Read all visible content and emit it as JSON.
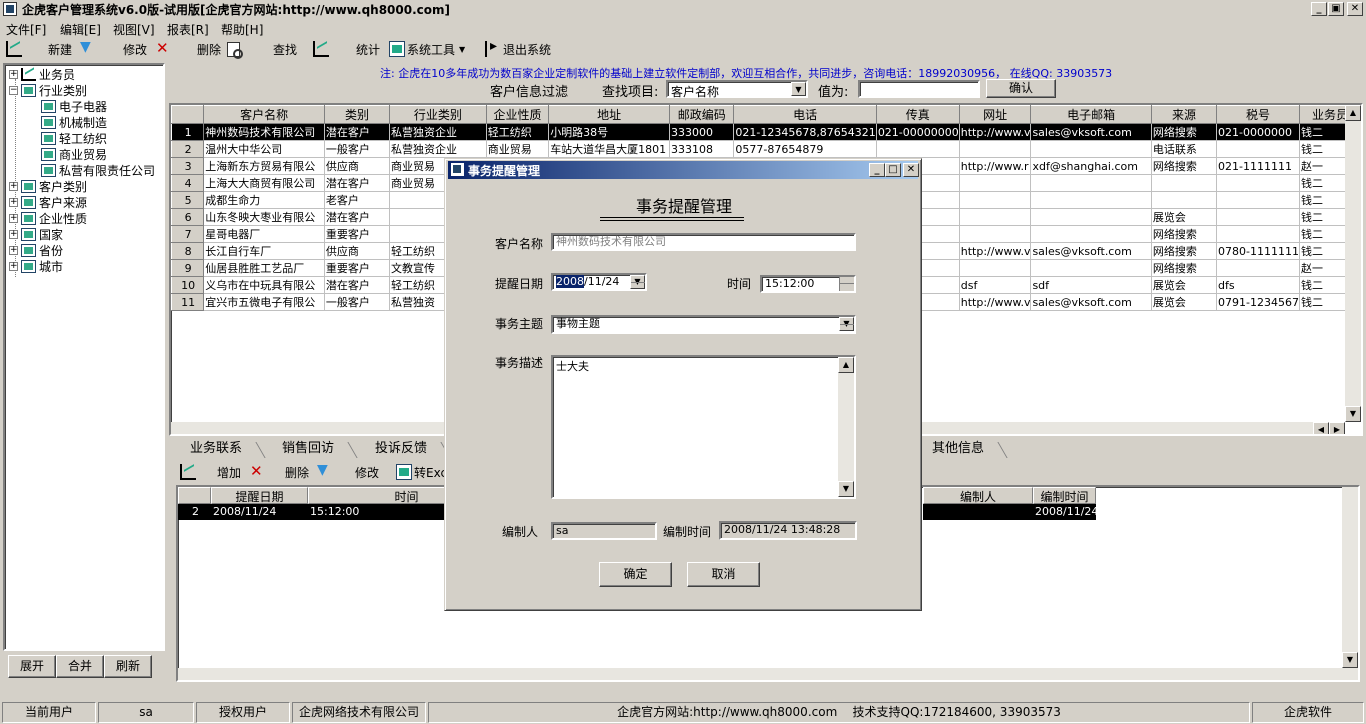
{
  "window": {
    "title": "企虎客户管理系统v6.0版-试用版[企虎官方网站:http://www.qh8000.com]",
    "caption_buttons": [
      "_",
      "▣",
      "✕"
    ]
  },
  "menu": [
    "文件[F]",
    "编辑[E]",
    "视图[V]",
    "报表[R]",
    "帮助[H]"
  ],
  "toolbar": {
    "new": "新建",
    "edit": "修改",
    "delete": "删除",
    "find": "查找",
    "stats": "统计",
    "tools": "系统工具",
    "exit": "退出系统"
  },
  "tree": {
    "nodes": [
      {
        "label": "业务员",
        "expander": "+",
        "level": 0
      },
      {
        "label": "行业类别",
        "expander": "−",
        "level": 0
      },
      {
        "label": "电子电器",
        "level": 1
      },
      {
        "label": "机械制造",
        "level": 1
      },
      {
        "label": "轻工纺织",
        "level": 1
      },
      {
        "label": "商业贸易",
        "level": 1
      },
      {
        "label": "私营有限责任公司",
        "level": 1
      },
      {
        "label": "客户类别",
        "expander": "+",
        "level": 0
      },
      {
        "label": "客户来源",
        "expander": "+",
        "level": 0
      },
      {
        "label": "企业性质",
        "expander": "+",
        "level": 0
      },
      {
        "label": "国家",
        "expander": "+",
        "level": 0
      },
      {
        "label": "省份",
        "expander": "+",
        "level": 0
      },
      {
        "label": "城市",
        "expander": "+",
        "level": 0
      }
    ],
    "buttons": {
      "expand": "展开",
      "collapse": "合并",
      "refresh": "刷新"
    }
  },
  "notice": "注: 企虎在10多年成功为数百家企业定制软件的基础上建立软件定制部，欢迎互相合作，共同进步，咨询电话：18992030956， 在线QQ: 33903573",
  "filter": {
    "title": "客户信息过滤",
    "item_label": "查找项目:",
    "item_value": "客户名称",
    "value_label": "值为:",
    "value": "",
    "confirm": "确认"
  },
  "grid": {
    "columns": [
      "",
      "客户名称",
      "类别",
      "行业类别",
      "企业性质",
      "地址",
      "邮政编码",
      "电话",
      "传真",
      "网址",
      "电子邮箱",
      "来源",
      "税号",
      "业务员"
    ],
    "rows": [
      [
        "1",
        "神州数码技术有限公司",
        "潜在客户",
        "私营独资企业",
        "轻工纺织",
        "小明路38号",
        "333000",
        "021-12345678,87654321",
        "021-00000000",
        "http://www.v",
        "sales@vksoft.com",
        "网络搜索",
        "021-0000000",
        "钱二"
      ],
      [
        "2",
        "温州大中华公司",
        "一般客户",
        "私营独资企业",
        "商业贸易",
        "车站大道华昌大厦1801",
        "333108",
        "0577-87654879",
        "",
        "",
        "",
        "电话联系",
        "",
        "钱二"
      ],
      [
        "3",
        "上海新东方贸易有限公",
        "供应商",
        "商业贸易",
        "",
        "",
        "",
        "",
        "",
        "http://www.r",
        "xdf@shanghai.com",
        "网络搜索",
        "021-1111111",
        "赵一"
      ],
      [
        "4",
        "上海大大商贸有限公司",
        "潜在客户",
        "商业贸易",
        "",
        "",
        "",
        "",
        "",
        "",
        "",
        "",
        "",
        "钱二"
      ],
      [
        "5",
        "成都生命力",
        "老客户",
        "",
        "",
        "",
        "",
        "",
        "",
        "",
        "",
        "",
        "",
        "钱二"
      ],
      [
        "6",
        "山东冬映大枣业有限公",
        "潜在客户",
        "",
        "",
        "",
        "",
        "",
        "",
        "",
        "",
        "展览会",
        "",
        "钱二"
      ],
      [
        "7",
        "星哥电器厂",
        "重要客户",
        "",
        "",
        "",
        "",
        "",
        "",
        "",
        "",
        "网络搜索",
        "",
        "钱二"
      ],
      [
        "8",
        "长江自行车厂",
        "供应商",
        "轻工纺织",
        "",
        "",
        "",
        "",
        "",
        "http://www.v",
        "sales@vksoft.com",
        "网络搜索",
        "0780-1111111",
        "钱二"
      ],
      [
        "9",
        "仙居县胜胜工艺品厂",
        "重要客户",
        "文教宣传",
        "",
        "",
        "",
        "",
        "",
        "",
        "",
        "网络搜索",
        "",
        "赵一"
      ],
      [
        "10",
        "义乌市在中玩具有限公",
        "潜在客户",
        "轻工纺织",
        "",
        "",
        "",
        "",
        "",
        "dsf",
        "sdf",
        "展览会",
        "dfs",
        "钱二"
      ],
      [
        "11",
        "宜兴市五微电子有限公",
        "一般客户",
        "私营独资",
        "",
        "",
        "",
        "",
        "",
        "http://www.v",
        "sales@vksoft.com",
        "展览会",
        "0791-1234567",
        "钱二"
      ]
    ]
  },
  "tabs": [
    "业务联系",
    "销售回访",
    "投诉反馈",
    "其他信息"
  ],
  "subtoolbar": {
    "add": "增加",
    "delete": "删除",
    "edit": "修改",
    "export": "转Exc"
  },
  "subgrid": {
    "headers": {
      "date": "提醒日期",
      "time": "时间",
      "editor": "编制人",
      "edit_time": "编制时间"
    },
    "row": {
      "num": "2",
      "date": "2008/11/24",
      "time": "15:12:00",
      "edit_time": "2008/11/24"
    }
  },
  "status": {
    "current_user_label": "当前用户",
    "current_user": "sa",
    "licensed_label": "授权用户",
    "licensed": "企虎网络技术有限公司",
    "site": "企虎官方网站:http://www.qh8000.com",
    "support": "技术支持QQ:172184600, 33903573",
    "brand": "企虎软件"
  },
  "dialog": {
    "title": "事务提醒管理",
    "heading": "事务提醒管理",
    "customer_label": "客户名称",
    "customer": "神州数码技术有限公司",
    "date_label": "提醒日期",
    "date_year": "2008",
    "date_rest": "/11/24",
    "time_label": "时间",
    "time": "15:12:00",
    "subject_label": "事务主题",
    "subject": "事物主题",
    "desc_label": "事务描述",
    "desc": "士大夫",
    "editor_label": "编制人",
    "editor": "sa",
    "edit_time_label": "编制时间",
    "edit_time": "2008/11/24 13:48:28",
    "ok": "确定",
    "cancel": "取消"
  }
}
